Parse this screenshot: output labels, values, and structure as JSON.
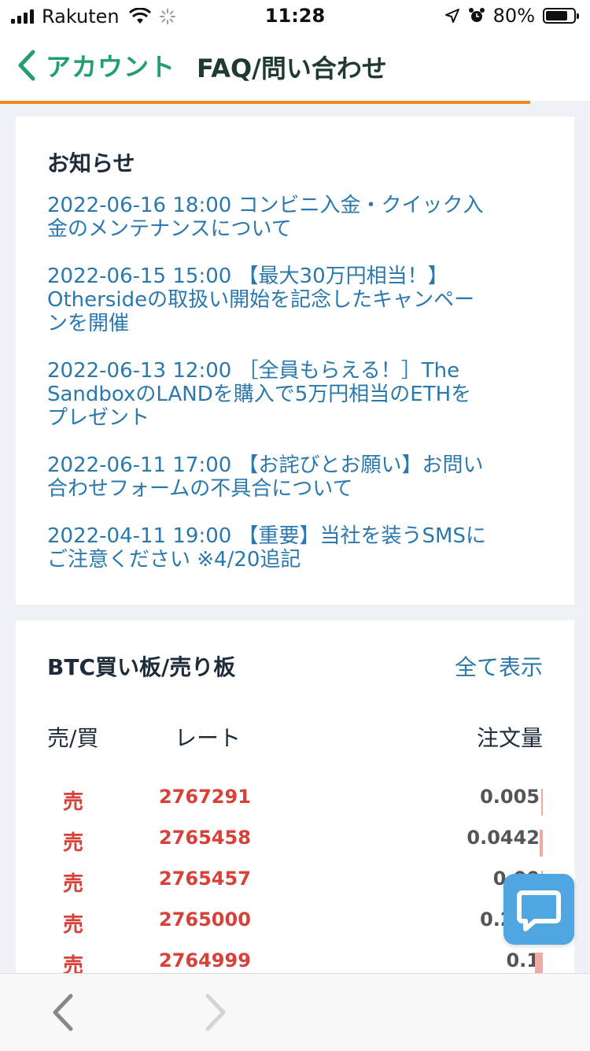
{
  "status_bar": {
    "carrier": "Rakuten",
    "time": "11:28",
    "battery": "80%",
    "battery_level": 0.8
  },
  "nav": {
    "back_label": "アカウント",
    "title": "FAQ/問い合わせ",
    "accent_color": "#22a06b",
    "progress_color": "#ee8a1c"
  },
  "news": {
    "heading": "お知らせ",
    "items": [
      {
        "line1": "2022-06-16 18:00 コンビニ入金・クイック入",
        "line2": "金のメンテナンスについて",
        "line3": ""
      },
      {
        "line1": "2022-06-15 15:00 【最大30万円相当！】",
        "line2": "Othersideの取扱い開始を記念したキャンペー",
        "line3": "ンを開催"
      },
      {
        "line1": "2022-06-13 12:00 ［全員もらえる！］The",
        "line2": "SandboxのLANDを購入で5万円相当のETHを",
        "line3": "プレゼント"
      },
      {
        "line1": "2022-06-11 17:00 【お詫びとお願い】お問い",
        "line2": "合わせフォームの不具合について",
        "line3": ""
      },
      {
        "line1": "2022-04-11 19:00 【重要】当社を装うSMSに",
        "line2": "ご注意ください ※4/20追記",
        "line3": ""
      }
    ]
  },
  "board": {
    "heading": "BTC買い板/売り板",
    "show_all": "全て表示",
    "col_side": "売/買",
    "col_rate": "レート",
    "col_qty": "注文量",
    "rows": [
      {
        "side": "売",
        "rate": "2767291",
        "qty": "0.005",
        "bar": 0.03
      },
      {
        "side": "売",
        "rate": "2765458",
        "qty": "0.0442",
        "bar": 0.19
      },
      {
        "side": "売",
        "rate": "2765457",
        "qty": "0.00",
        "bar": 0.03
      },
      {
        "side": "売",
        "rate": "2765000",
        "qty": "0.202",
        "bar": 0.9
      },
      {
        "side": "売",
        "rate": "2764999",
        "qty": "0.1",
        "bar": 0.45
      }
    ]
  },
  "icons": {
    "chat": "chat-bubble-icon",
    "back": "chevron-left-icon",
    "forward": "chevron-right-icon"
  }
}
